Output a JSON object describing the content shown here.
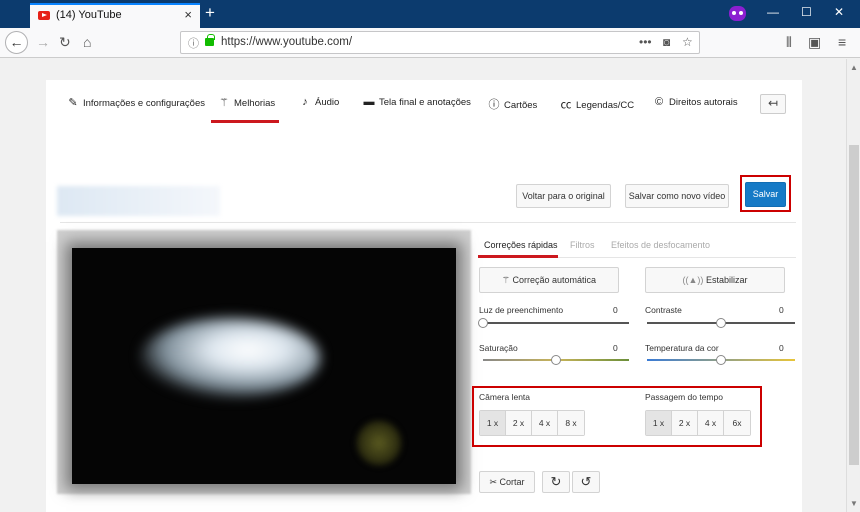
{
  "browser": {
    "tab_title": "(14) YouTube",
    "url": "https://www.youtube.com/",
    "info_icon": "info-icon",
    "lock_icon": "lock-icon"
  },
  "topnav": {
    "items": [
      {
        "label": "Informações e configurações",
        "icon": "pencil-icon"
      },
      {
        "label": "Melhorias",
        "icon": "magic-wand-icon"
      },
      {
        "label": "Áudio",
        "icon": "music-note-icon"
      },
      {
        "label": "Tela final e anotações",
        "icon": "card-icon"
      },
      {
        "label": "Cartões",
        "icon": "info-circle-icon"
      },
      {
        "label": "Legendas/CC",
        "icon": "cc-icon"
      },
      {
        "label": "Direitos autorais",
        "icon": "copyright-icon"
      }
    ],
    "active_index": 1
  },
  "actions": {
    "revert": "Voltar para o original",
    "save_new": "Salvar como novo vídeo",
    "save": "Salvar"
  },
  "subtabs": [
    "Correções rápidas",
    "Filtros",
    "Efeitos de desfocamento"
  ],
  "quick_fix": {
    "auto": "Correção automática",
    "stabilize": "Estabilizar"
  },
  "sliders": [
    {
      "label": "Luz de preenchimento",
      "value": "0",
      "level": 0.0
    },
    {
      "label": "Contraste",
      "value": "0",
      "level": 0.5
    },
    {
      "label": "Saturação",
      "value": "0",
      "level": 0.5
    },
    {
      "label": "Temperatura da cor",
      "value": "0",
      "level": 0.5
    }
  ],
  "slow_motion": {
    "label": "Câmera lenta",
    "options": [
      "1 x",
      "2 x",
      "4 x",
      "8 x"
    ],
    "selected": 0
  },
  "timelapse": {
    "label": "Passagem do tempo",
    "options": [
      "1 x",
      "2 x",
      "4 x",
      "6x"
    ],
    "selected": 0
  },
  "tools": {
    "trim": "Cortar"
  },
  "colors": {
    "accent": "#cc181e",
    "primary": "#167ac6",
    "highlight": "#cc0000"
  }
}
